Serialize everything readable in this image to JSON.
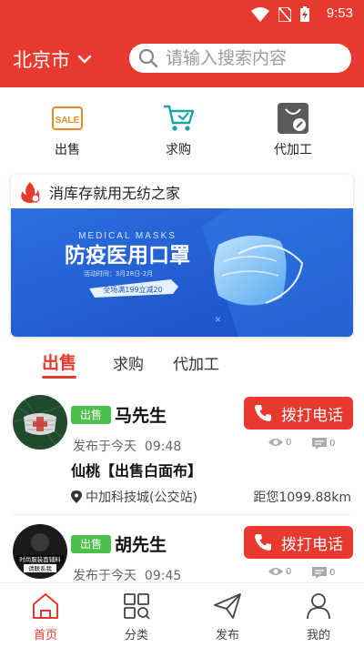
{
  "status_bar": {
    "time": "9:53"
  },
  "header": {
    "city": "北京市",
    "search_placeholder": "请输入搜索内容"
  },
  "categories": [
    {
      "label": "出售",
      "icon": "sale-tag-icon"
    },
    {
      "label": "求购",
      "icon": "shopping-cart-icon"
    },
    {
      "label": "代加工",
      "icon": "processing-bag-icon"
    }
  ],
  "promo": {
    "title": "消库存就用无纺之家",
    "banner": {
      "small_heading": "MEDICAL MASKS",
      "heading": "防疫医用口罩",
      "date_note": "活动时间：3月28日-2月",
      "ribbon": "全场满199立减20"
    }
  },
  "tabs": [
    "出售",
    "求购",
    "代加工"
  ],
  "active_tab": 0,
  "listings": [
    {
      "tag": "出售",
      "name": "马先生",
      "call_label": "拨打电话",
      "posted_prefix": "发布于今天",
      "posted_time": "09:48",
      "views": "0",
      "comments": "0",
      "product_title": "仙桃【出售白面布】",
      "location": "中加科技城(公交站)",
      "distance": "距您1099.88km"
    },
    {
      "tag": "出售",
      "name": "胡先生",
      "call_label": "拨打电话",
      "posted_prefix": "发布于今天",
      "posted_time": "09:45",
      "views": "0",
      "comments": "0",
      "avatar_text_1": "时尚服装面辅料",
      "avatar_text_2": "请联系我"
    }
  ],
  "bottom_nav": [
    {
      "label": "首页",
      "icon": "home-icon"
    },
    {
      "label": "分类",
      "icon": "category-grid-icon"
    },
    {
      "label": "发布",
      "icon": "paper-plane-icon"
    },
    {
      "label": "我的",
      "icon": "user-icon"
    }
  ],
  "colors": {
    "brand_red": "#e8392e",
    "tag_green": "#4cc04c"
  }
}
